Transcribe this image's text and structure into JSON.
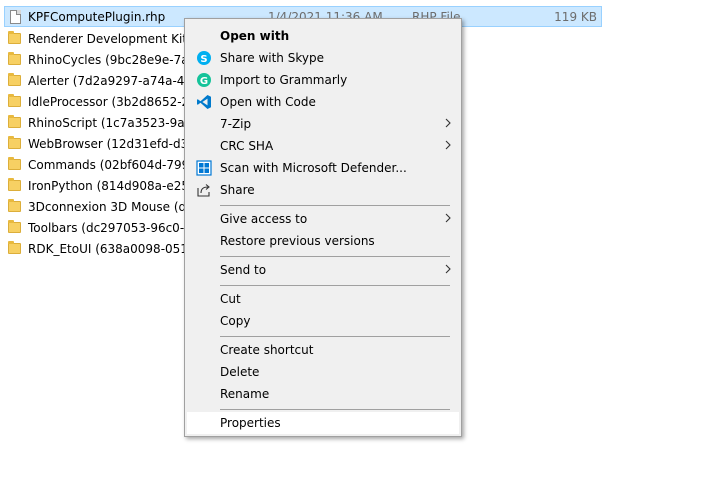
{
  "files": [
    {
      "name": "KPFComputePlugin.rhp",
      "date": "1/4/2021 11:36 AM",
      "type": "RHP File",
      "size": "119 KB",
      "kind": "file",
      "selected": true
    },
    {
      "name": "Renderer Development Kit (16",
      "kind": "folder"
    },
    {
      "name": "RhinoCycles (9bc28e9e-7a6c-4",
      "kind": "folder"
    },
    {
      "name": "Alerter (7d2a9297-a74a-4218-8",
      "kind": "folder"
    },
    {
      "name": "IdleProcessor (3b2d8652-2a2a",
      "kind": "folder"
    },
    {
      "name": "RhinoScript (1c7a3523-9a8f-4c",
      "kind": "folder"
    },
    {
      "name": "WebBrowser (12d31efd-d3ee-",
      "kind": "folder"
    },
    {
      "name": "Commands (02bf604d-799c-4",
      "kind": "folder"
    },
    {
      "name": "IronPython (814d908a-e25c-4",
      "kind": "folder"
    },
    {
      "name": "3Dconnexion 3D Mouse (dca0",
      "kind": "folder"
    },
    {
      "name": "Toolbars (dc297053-96c0-4883",
      "kind": "folder"
    },
    {
      "name": "RDK_EtoUI (638a0098-0511-48",
      "kind": "folder"
    }
  ],
  "menu": {
    "open_with": "Open with",
    "share_skype": "Share with Skype",
    "import_grammarly": "Import to Grammarly",
    "open_code": "Open with Code",
    "seven_zip": "7-Zip",
    "crc_sha": "CRC SHA",
    "scan_defender": "Scan with Microsoft Defender...",
    "share": "Share",
    "give_access": "Give access to",
    "restore_versions": "Restore previous versions",
    "send_to": "Send to",
    "cut": "Cut",
    "copy": "Copy",
    "create_shortcut": "Create shortcut",
    "delete": "Delete",
    "rename": "Rename",
    "properties": "Properties"
  },
  "icons": {
    "skype": "skype-icon",
    "grammarly": "grammarly-icon",
    "vscode": "vscode-icon",
    "defender": "defender-icon",
    "share": "share-icon",
    "submenu": "chevron-right-icon"
  },
  "colors": {
    "selection_bg": "#cce8ff",
    "selection_border": "#99d1ff",
    "menu_bg": "#f0f0f0",
    "skype_blue": "#00aff0",
    "grammarly_green": "#15c39a",
    "vscode_blue": "#007acc",
    "defender_blue": "#0078d4"
  }
}
